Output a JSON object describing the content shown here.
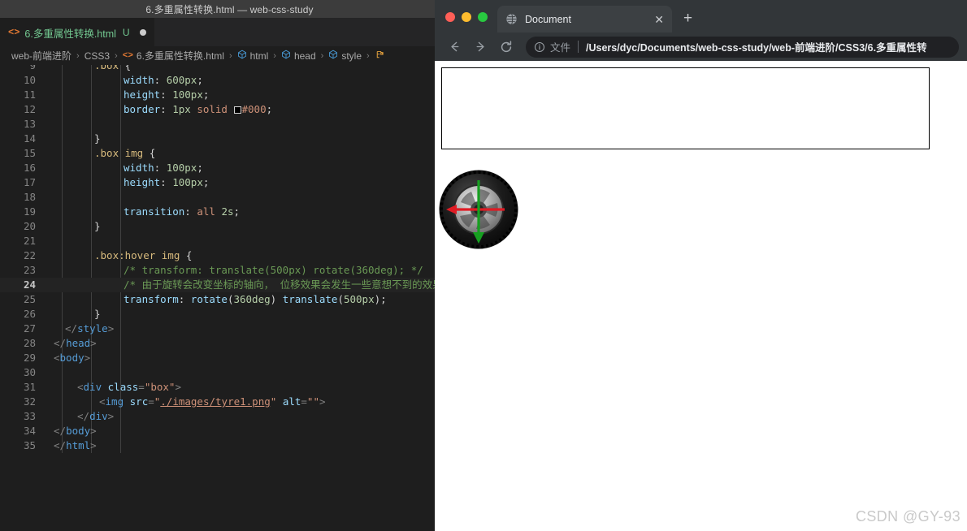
{
  "editor": {
    "window_title": "6.多重属性转换.html — web-css-study",
    "tab": {
      "icon": "html-file-icon",
      "filename": "6.多重属性转换.html",
      "git_badge": "U",
      "dirty": "●"
    },
    "breadcrumb": [
      {
        "label": "web-前端进阶",
        "icon": ""
      },
      {
        "label": "CSS3",
        "icon": ""
      },
      {
        "label": "6.多重属性转换.html",
        "icon": "html-file-icon"
      },
      {
        "label": "html",
        "icon": "symbol-cube-icon"
      },
      {
        "label": "head",
        "icon": "symbol-cube-icon"
      },
      {
        "label": "style",
        "icon": "symbol-cube-icon"
      },
      {
        "label": "",
        "icon": "css-rule-icon"
      }
    ],
    "breadcrumb_separator": "›",
    "active_line": 24,
    "lines": [
      {
        "n": 9,
        "text": ".box {"
      },
      {
        "n": 10,
        "text": "    width: 600px;"
      },
      {
        "n": 11,
        "text": "    height: 100px;"
      },
      {
        "n": 12,
        "text": "    border: 1px solid #000;"
      },
      {
        "n": 13,
        "text": ""
      },
      {
        "n": 14,
        "text": "}"
      },
      {
        "n": 15,
        "text": ".box img {"
      },
      {
        "n": 16,
        "text": "    width: 100px;"
      },
      {
        "n": 17,
        "text": "    height: 100px;"
      },
      {
        "n": 18,
        "text": ""
      },
      {
        "n": 19,
        "text": "    transition: all 2s;"
      },
      {
        "n": 20,
        "text": "}"
      },
      {
        "n": 21,
        "text": ""
      },
      {
        "n": 22,
        "text": ".box:hover img {"
      },
      {
        "n": 23,
        "text": "    /* transform: translate(500px) rotate(360deg); */"
      },
      {
        "n": 24,
        "text": "    /* 由于旋转会改变坐标的轴向， 位移效果会发生一些意想不到的效果"
      },
      {
        "n": 25,
        "text": "    transform: rotate(360deg) translate(500px);"
      },
      {
        "n": 26,
        "text": "}"
      },
      {
        "n": 27,
        "text": "</style>"
      },
      {
        "n": 28,
        "text": "</head>"
      },
      {
        "n": 29,
        "text": "<body>"
      },
      {
        "n": 30,
        "text": ""
      },
      {
        "n": 31,
        "text": "<div class=\"box\">"
      },
      {
        "n": 32,
        "text": "<img src=\"./images/tyre1.png\" alt=\"\">"
      },
      {
        "n": 33,
        "text": "</div>"
      },
      {
        "n": 34,
        "text": "</body>"
      },
      {
        "n": 35,
        "text": "</html>"
      }
    ]
  },
  "browser": {
    "tab": {
      "title": "Document",
      "favicon": "globe-icon",
      "close": "✕"
    },
    "new_tab": "+",
    "nav": {
      "back": "←",
      "forward": "→",
      "reload": "↻"
    },
    "omnibox": {
      "info_icon": "info-circle-icon",
      "scheme_label": "文件",
      "url": "/Users/dyc/Documents/web-css-study/web-前端进阶/CSS3/6.多重属性转"
    },
    "page": {
      "box_border_color": "#000000",
      "image_alt": "tyre1.png",
      "watermark": "CSDN @GY-93"
    }
  },
  "colors": {
    "editor_bg": "#1e1e1e",
    "titlebar_bg": "#3c3c3c",
    "tabbar_bg": "#252526",
    "chrome_bg": "#323639",
    "omnibox_bg": "#202124",
    "comment": "#6a9955",
    "selector": "#d7ba7d",
    "property": "#9cdcfe",
    "value": "#ce9178",
    "number": "#b5cea8",
    "tag": "#569cd6",
    "arrow_horizontal": "#e01b24",
    "arrow_vertical": "#1a9e2a"
  }
}
